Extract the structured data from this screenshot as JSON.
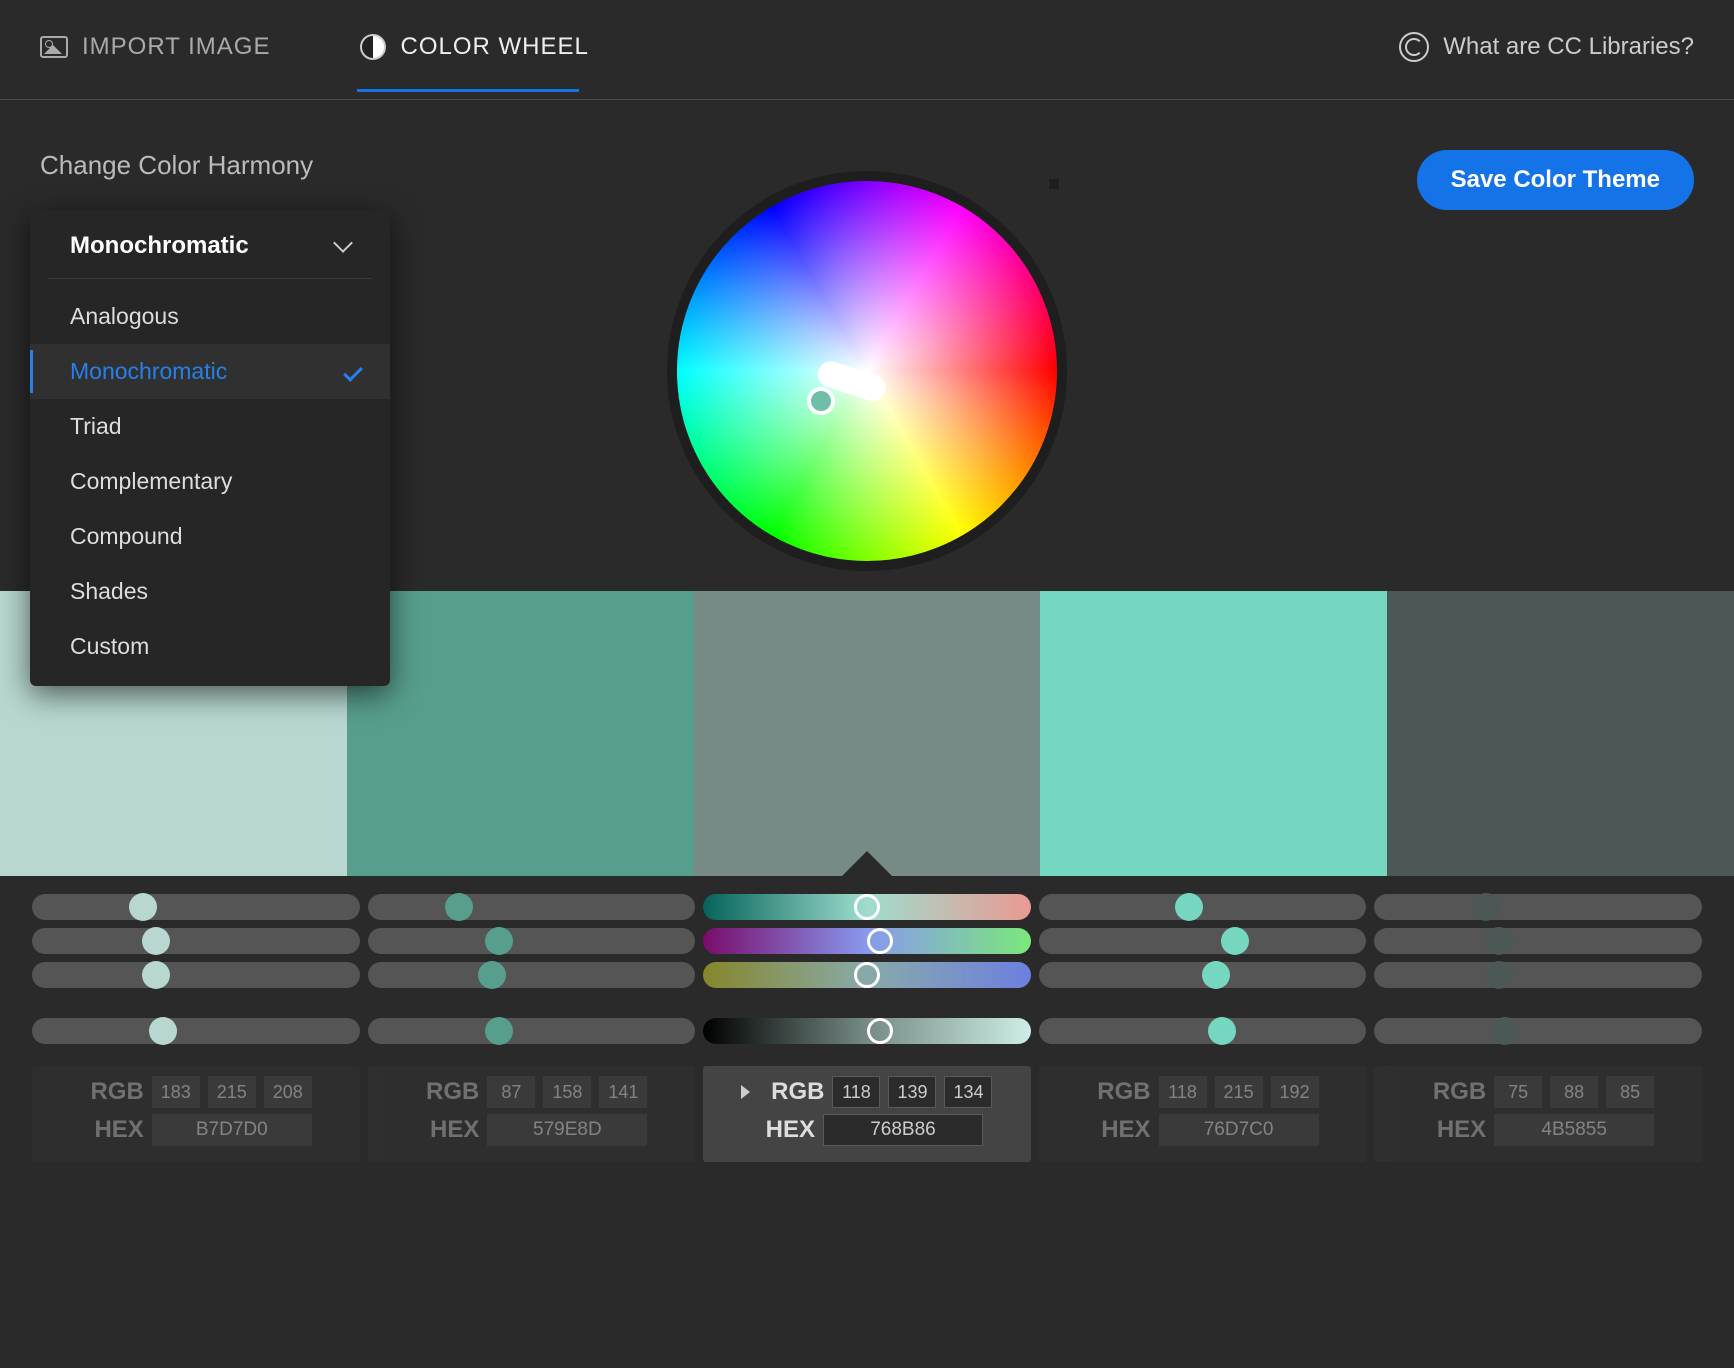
{
  "tabs": {
    "import": "IMPORT IMAGE",
    "wheel": "COLOR WHEEL",
    "cc_link": "What are CC Libraries?"
  },
  "harmony_label": "Change Color Harmony",
  "save_button": "Save Color Theme",
  "dropdown": {
    "selected": "Monochromatic",
    "items": [
      "Analogous",
      "Monochromatic",
      "Triad",
      "Complementary",
      "Compound",
      "Shades",
      "Custom"
    ],
    "selected_index": 1
  },
  "swatches": [
    {
      "hex": "B7D7D0",
      "rgb": [
        183,
        215,
        208
      ],
      "css": "#b7d7d0"
    },
    {
      "hex": "579E8D",
      "rgb": [
        87,
        158,
        141
      ],
      "css": "#579e8d"
    },
    {
      "hex": "768B86",
      "rgb": [
        118,
        139,
        134
      ],
      "css": "#768b86",
      "active": true
    },
    {
      "hex": "76D7C0",
      "rgb": [
        118,
        215,
        192
      ],
      "css": "#76d7c0"
    },
    {
      "hex": "4B5855",
      "rgb": [
        75,
        88,
        85
      ],
      "css": "#4b5855"
    }
  ],
  "value_labels": {
    "rgb": "RGB",
    "hex": "HEX"
  },
  "active_swatch_index": 2,
  "slider_thumbs_pct": {
    "row1": [
      34,
      28,
      50,
      46,
      34
    ],
    "row2": [
      38,
      40,
      54,
      60,
      38
    ],
    "row3": [
      38,
      38,
      50,
      54,
      38
    ],
    "rowB": [
      40,
      40,
      54,
      56,
      40
    ]
  }
}
